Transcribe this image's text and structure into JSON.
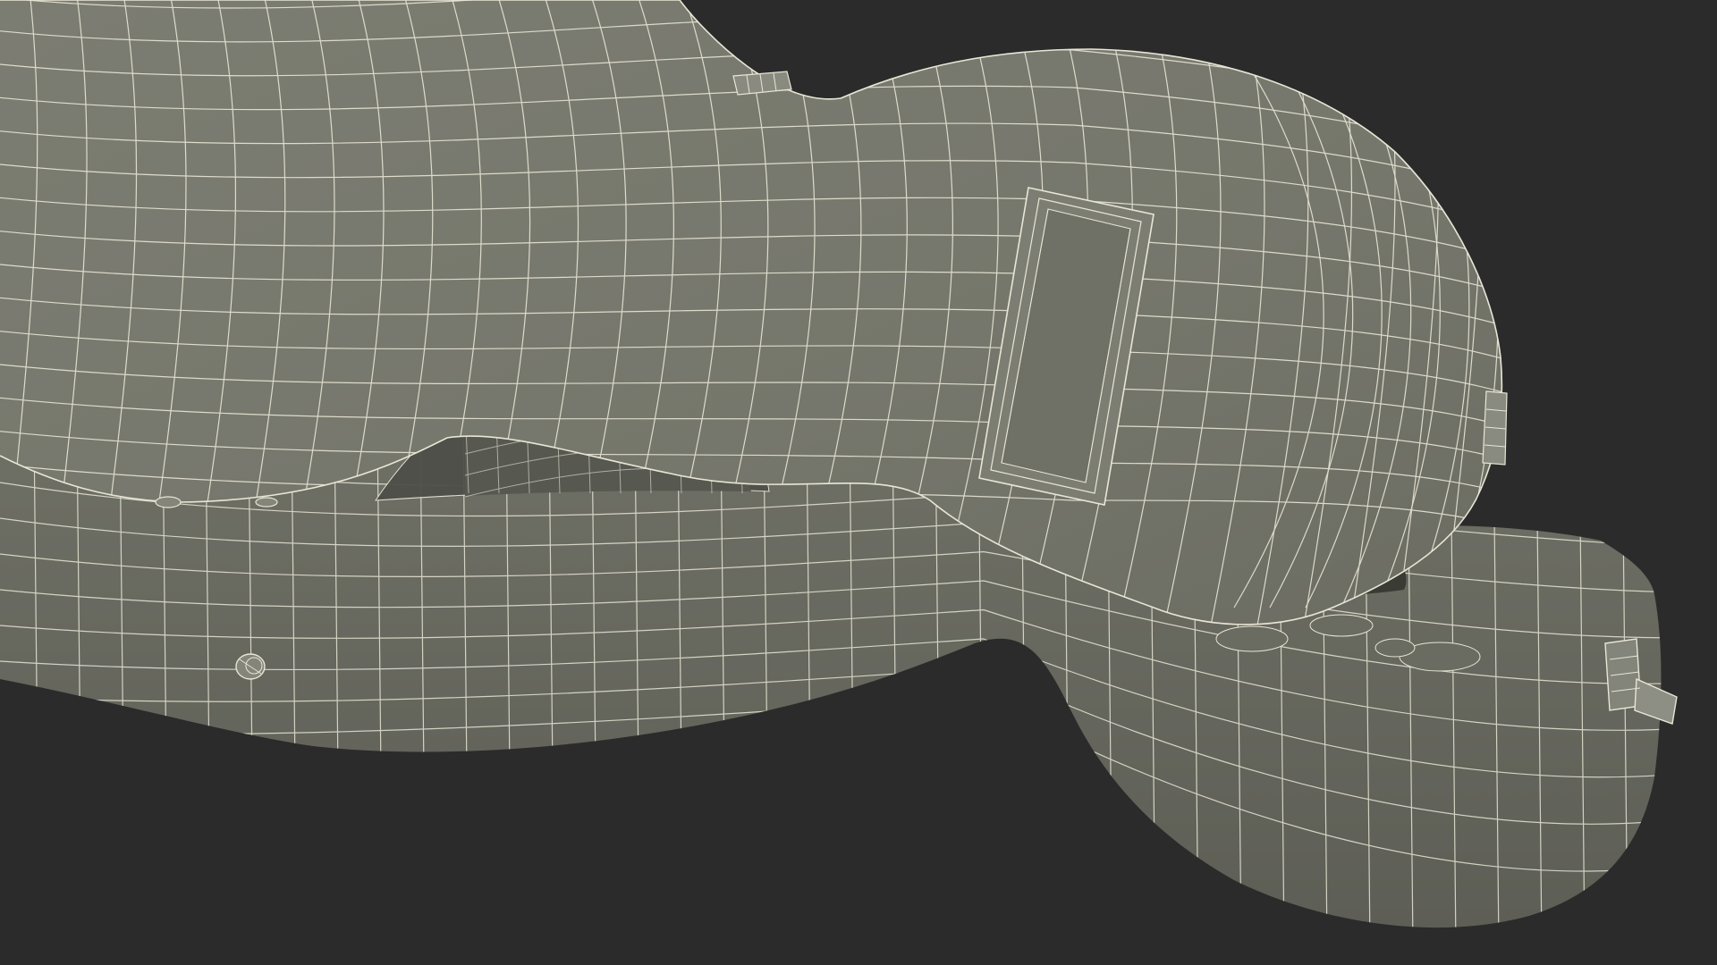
{
  "scene": {
    "subject": "guitar-case-wireframe",
    "colors": {
      "background": "#2b2b2b",
      "surface": "#7a7b70",
      "surface_light": "#85867b",
      "surface_dark": "#5e5f56",
      "interior": "#4d4e47",
      "wire": "#e8e6d6"
    }
  }
}
